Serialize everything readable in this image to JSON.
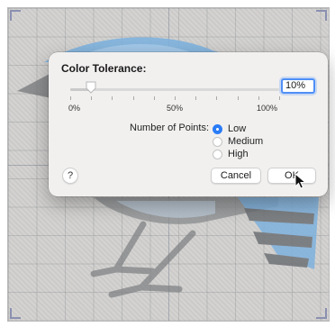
{
  "dialog": {
    "title": "Color Tolerance:",
    "slider": {
      "value_percent": 10,
      "labels": {
        "min": "0%",
        "mid": "50%",
        "max": "100%"
      }
    },
    "tolerance_field_value": "10%",
    "points": {
      "label": "Number of Points:",
      "options": [
        "Low",
        "Medium",
        "High"
      ],
      "selected": "Low"
    },
    "help_label": "?",
    "buttons": {
      "cancel": "Cancel",
      "ok": "OK"
    }
  },
  "colors": {
    "accent": "#2b7cf6",
    "focus_ring": "#4f8ff7",
    "canvas_bg": "#d2d1cf",
    "bird_blue": "#7fb2de",
    "bird_gray": "#8b8d8f"
  },
  "icons": [
    "help-icon",
    "pointer-cursor-icon"
  ]
}
